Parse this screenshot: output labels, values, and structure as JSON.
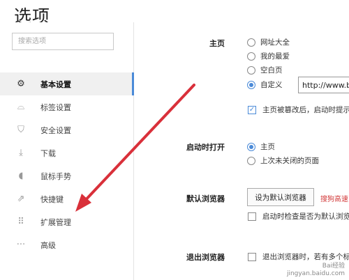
{
  "window": {
    "title": "选项"
  },
  "search": {
    "placeholder": "搜索选项"
  },
  "sidebar": {
    "items": [
      {
        "label": "基本设置",
        "icon": "gear-icon",
        "glyph": "⚙",
        "active": true
      },
      {
        "label": "标签设置",
        "icon": "tab-icon",
        "glyph": "⌓",
        "active": false
      },
      {
        "label": "安全设置",
        "icon": "shield-icon",
        "glyph": "⛉",
        "active": false
      },
      {
        "label": "下载",
        "icon": "download-icon",
        "glyph": "⤓",
        "active": false
      },
      {
        "label": "鼠标手势",
        "icon": "mouse-icon",
        "glyph": "◖",
        "active": false
      },
      {
        "label": "快捷键",
        "icon": "shortcut-icon",
        "glyph": "⇗",
        "active": false
      },
      {
        "label": "扩展管理",
        "icon": "extensions-icon",
        "glyph": "⠿",
        "active": false
      },
      {
        "label": "高级",
        "icon": "more-icon",
        "glyph": "···",
        "active": false
      }
    ]
  },
  "homepage": {
    "label": "主页",
    "options": [
      "网址大全",
      "我的最爱",
      "空白页",
      "自定义"
    ],
    "selected_index": 3,
    "url_value": "http://www.b",
    "tamper_check_label": "主页被篡改后，启动时提示",
    "tamper_checked": true
  },
  "startup": {
    "label": "启动时打开",
    "options": [
      "主页",
      "上次未关闭的页面"
    ],
    "selected_index": 0
  },
  "default_browser": {
    "label": "默认浏览器",
    "button_label": "设为默认浏览器",
    "warning_text": "搜狗高速",
    "check_label": "启动时检查是否为默认浏览",
    "checked": false
  },
  "exit_browser": {
    "label": "退出浏览器",
    "check_label": "退出浏览器时，若有多个标签",
    "checked": false
  },
  "watermark": {
    "line1": "Bai经验",
    "line2": "jingyan.baidu.com"
  },
  "colors": {
    "accent": "#4a8ad8",
    "arrow": "#d9303a",
    "warning": "#d23a3a"
  }
}
